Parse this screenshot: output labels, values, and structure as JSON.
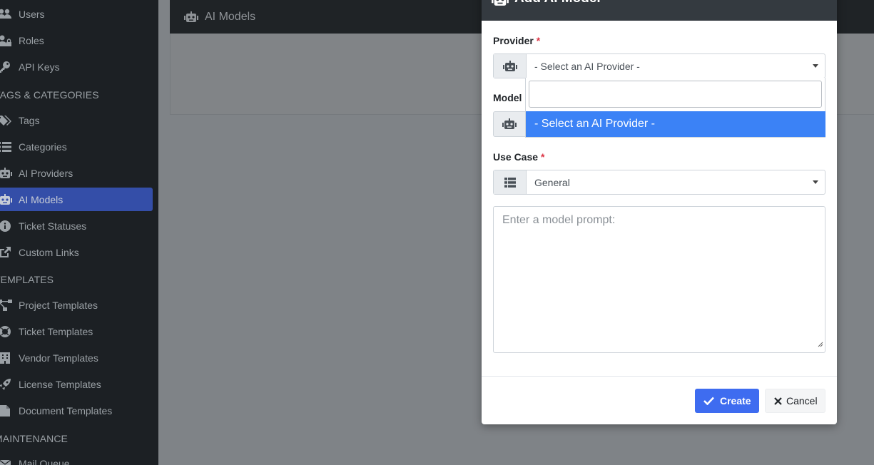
{
  "sidebar": {
    "items": [
      {
        "label": "Users",
        "icon": "users-icon"
      },
      {
        "label": "Roles",
        "icon": "user-lock-icon"
      },
      {
        "label": "API Keys",
        "icon": "key-icon"
      },
      {
        "label": "Tags",
        "icon": "tags-icon"
      },
      {
        "label": "Categories",
        "icon": "list-icon"
      },
      {
        "label": "AI Providers",
        "icon": "robot-icon"
      },
      {
        "label": "AI Models",
        "icon": "robot-icon"
      },
      {
        "label": "Ticket Statuses",
        "icon": "info-circle-icon"
      },
      {
        "label": "Custom Links",
        "icon": "external-link-icon"
      },
      {
        "label": "Project Templates",
        "icon": "project-diagram-icon"
      },
      {
        "label": "Ticket Templates",
        "icon": "life-ring-icon"
      },
      {
        "label": "Vendor Templates",
        "icon": "building-icon"
      },
      {
        "label": "License Templates",
        "icon": "rocket-icon"
      },
      {
        "label": "Document Templates",
        "icon": "file-icon"
      },
      {
        "label": "Mail Queue",
        "icon": "mail-icon"
      }
    ],
    "headers": [
      "TAGS & CATEGORIES",
      "TEMPLATES",
      "MAINTENANCE"
    ],
    "active_item": "AI Models"
  },
  "page": {
    "title": "AI Models"
  },
  "modal": {
    "title": "Add AI Model",
    "close_label": "×",
    "provider": {
      "label": "Provider",
      "required_mark": "*",
      "selected": "- Select an AI Provider -"
    },
    "model": {
      "label": "Model",
      "search_value": "",
      "highlighted_option": "- Select an AI Provider -"
    },
    "use_case": {
      "label": "Use Case",
      "required_mark": "*",
      "selected": "General"
    },
    "prompt": {
      "placeholder": "Enter a model prompt:"
    },
    "buttons": {
      "create": "Create",
      "cancel": "Cancel"
    }
  },
  "colors": {
    "sidebar_bg": "#1c2024",
    "active_item_bg": "#344ea8",
    "modal_header_bg": "#343a40",
    "primary": "#3e6cf0",
    "highlight_option": "#3b82f6",
    "required": "#dc3545"
  }
}
